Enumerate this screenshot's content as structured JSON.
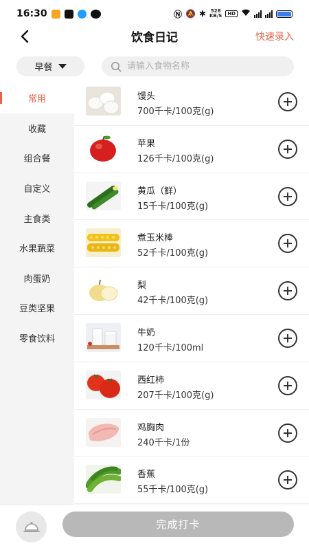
{
  "status_bar": {
    "time": "16:30",
    "net_speed_value": "528",
    "net_speed_unit": "KB/S",
    "hd_label": "HD",
    "battery_label": "电量"
  },
  "header": {
    "title": "饮食日记",
    "quick_entry_label": "快速录入"
  },
  "meal_selector": {
    "selected": "早餐"
  },
  "search": {
    "placeholder": "请输入食物名称"
  },
  "categories": [
    {
      "label": "常用",
      "active": true
    },
    {
      "label": "收藏"
    },
    {
      "label": "组合餐"
    },
    {
      "label": "自定义"
    },
    {
      "label": "主食类"
    },
    {
      "label": "水果蔬菜"
    },
    {
      "label": "肉蛋奶"
    },
    {
      "label": "豆类坚果"
    },
    {
      "label": "零食饮料"
    }
  ],
  "foods": [
    {
      "name": "馒头",
      "calories": "700千卡/100克(g)",
      "icon": "steamed-bun"
    },
    {
      "name": "苹果",
      "calories": "126千卡/100克(g)",
      "icon": "apple"
    },
    {
      "name": "黄瓜（鲜）",
      "calories": "15千卡/100克(g)",
      "icon": "cucumber"
    },
    {
      "name": "煮玉米棒",
      "calories": "52千卡/100克(g)",
      "icon": "corn"
    },
    {
      "name": "梨",
      "calories": "42千卡/100克(g)",
      "icon": "pear"
    },
    {
      "name": "牛奶",
      "calories": "120千卡/100ml",
      "icon": "milk"
    },
    {
      "name": "西红柿",
      "calories": "207千卡/100克(g)",
      "icon": "tomato"
    },
    {
      "name": "鸡胸肉",
      "calories": "240千卡/1份",
      "icon": "chicken-breast"
    },
    {
      "name": "香蕉",
      "calories": "55千卡/100克(g)",
      "icon": "banana"
    }
  ],
  "bottom": {
    "finish_label": "完成打卡",
    "tray_icon": "food-tray-icon"
  },
  "colors": {
    "accent": "#e8624a",
    "sidebar_bg": "#f4f4f4",
    "button_disabled": "#b8b8b8"
  }
}
